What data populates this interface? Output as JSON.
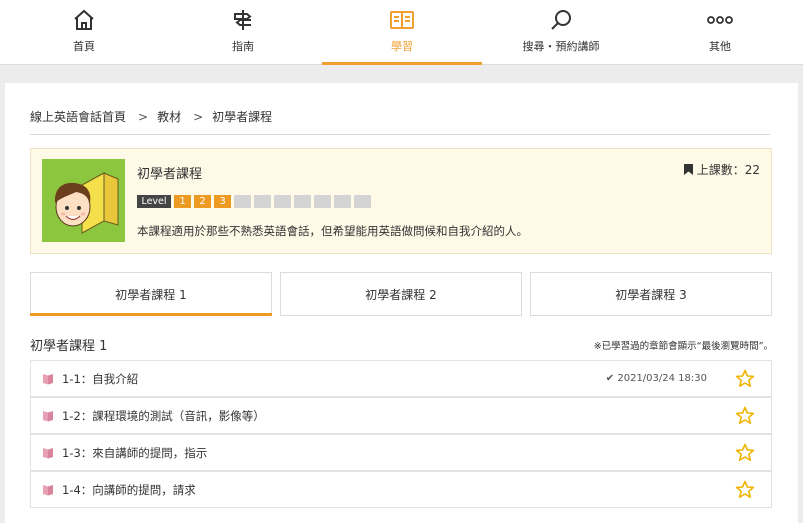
{
  "nav": [
    {
      "label": "首頁",
      "icon": "home-icon"
    },
    {
      "label": "指南",
      "icon": "signpost-icon"
    },
    {
      "label": "學習",
      "icon": "book-icon"
    },
    {
      "label": "搜尋・預約講師",
      "icon": "search-icon"
    },
    {
      "label": "其他",
      "icon": "more-icon"
    }
  ],
  "breadcrumb": [
    "線上英語會話首頁",
    "教材",
    "初學者課程"
  ],
  "breadcrumb_sep": ">",
  "course": {
    "title": "初學者課程",
    "lesson_count": "上課數：22",
    "level_label": "Level",
    "levels_on": [
      "1",
      "2",
      "3"
    ],
    "levels_total": 10,
    "description": "本課程適用於那些不熟悉英語會話，但希望能用英語做問候和自我介紹的人。"
  },
  "tabs": [
    "初學者課程 1",
    "初學者課程 2",
    "初學者課程 3"
  ],
  "section": {
    "title": "初學者課程 1",
    "note": "※已學習過的章節會顯示“最後瀏覽時間”。"
  },
  "lessons": [
    {
      "title": "1-1：自我介紹",
      "viewed": "2021/03/24 18:30"
    },
    {
      "title": "1-2：課程環境的測試（音訊，影像等）",
      "viewed": ""
    },
    {
      "title": "1-3：來自講師的提問，指示",
      "viewed": ""
    },
    {
      "title": "1-4：向講師的提問，請求",
      "viewed": ""
    }
  ],
  "colors": {
    "accent": "#ec9a22",
    "star": "#f0b400",
    "book": "#e8a0b4"
  }
}
